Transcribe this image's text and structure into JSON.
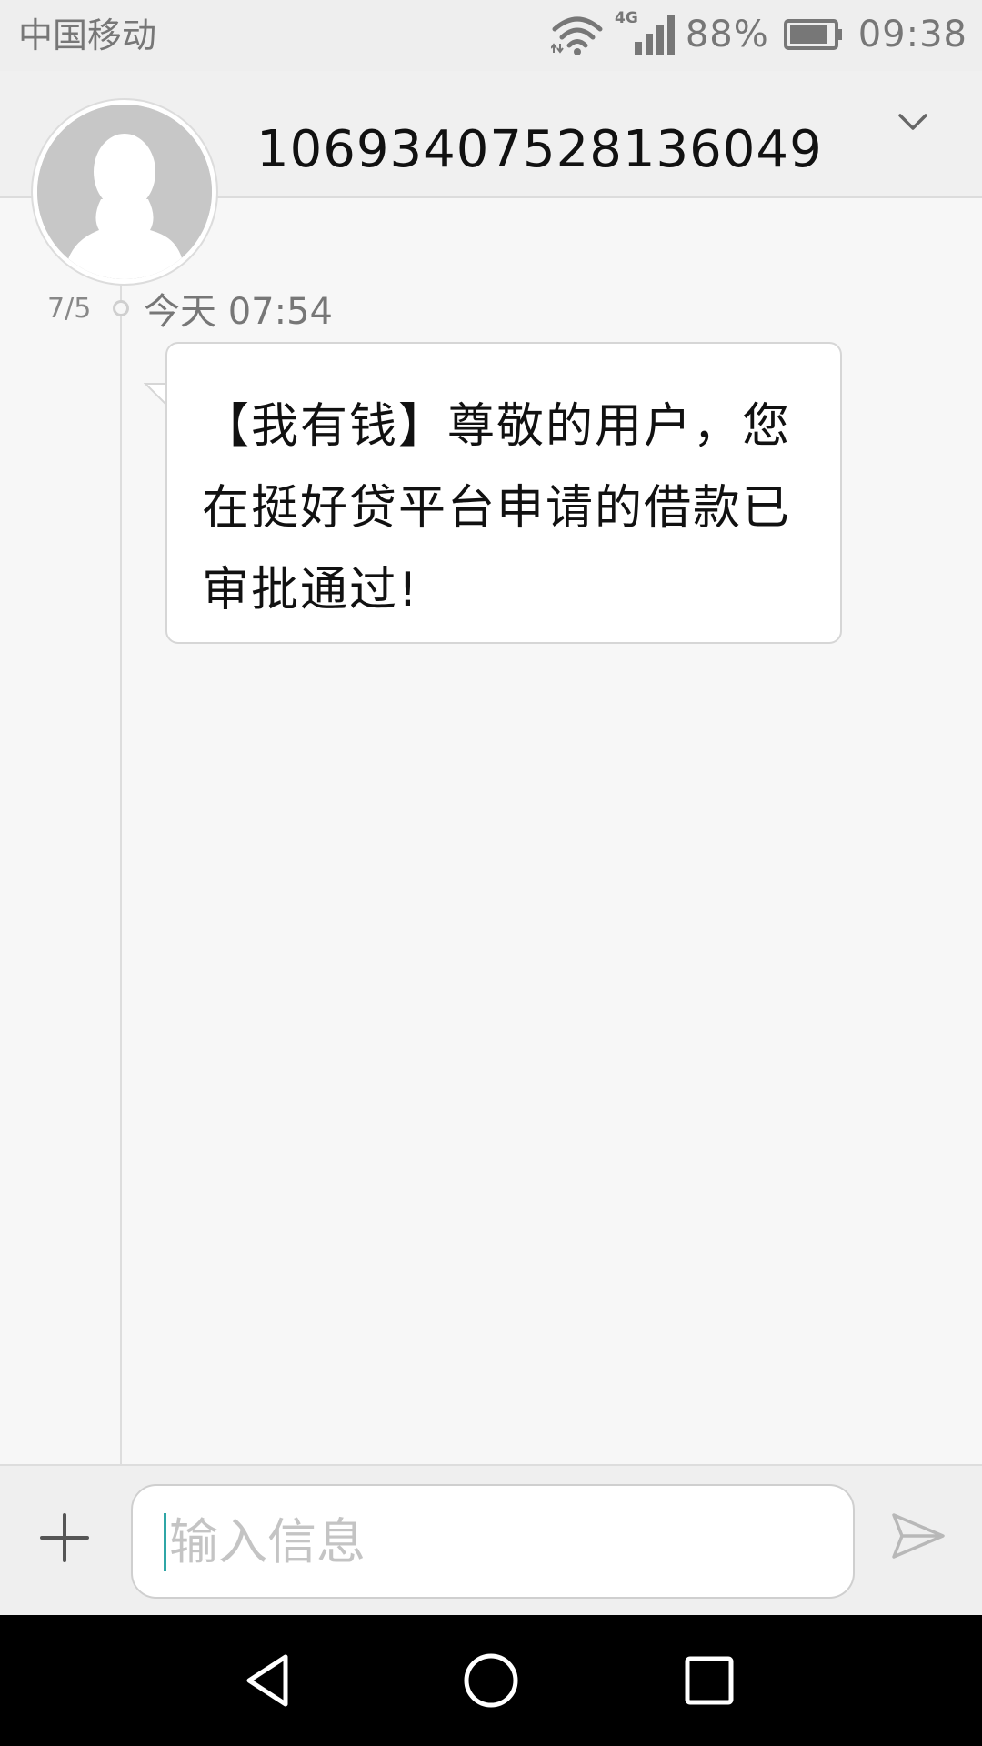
{
  "status_bar": {
    "carrier": "中国移动",
    "network_type": "4G",
    "battery_percent": "88%",
    "battery_level": 0.88,
    "time": "09:38",
    "icons": [
      "wifi-icon",
      "signal-icon",
      "battery-icon"
    ]
  },
  "header": {
    "contact": "10693407528136049",
    "avatar_icon": "default-avatar-icon",
    "expand_icon": "chevron-down-icon"
  },
  "conversation": {
    "date": "7/5",
    "time": "今天 07:54",
    "messages": [
      {
        "direction": "incoming",
        "text": "【我有钱】尊敬的用户，您在挺好贷平台申请的借款已审批通过!"
      }
    ]
  },
  "composer": {
    "placeholder": "输入信息",
    "value": "",
    "add_icon": "plus-icon",
    "send_icon": "send-icon"
  },
  "nav_bar": {
    "icons": [
      "back-icon",
      "home-icon",
      "recent-apps-icon"
    ]
  },
  "colors": {
    "cursor": "#2fa6a6",
    "bubble_bg": "#ffffff",
    "background": "#f7f7f7"
  }
}
